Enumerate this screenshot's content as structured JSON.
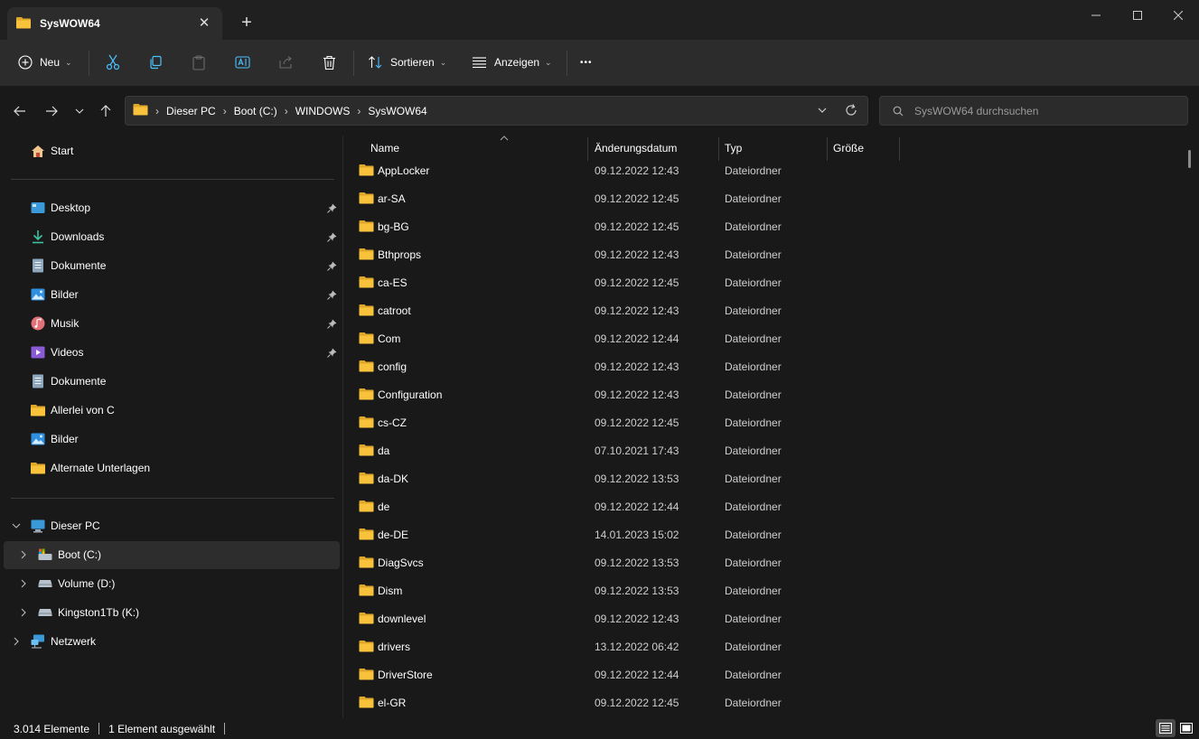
{
  "window": {
    "tab_title": "SysWOW64",
    "new_tab_glyph": "+",
    "close_glyph": "✕"
  },
  "toolbar": {
    "new_label": "Neu",
    "sort_label": "Sortieren",
    "view_label": "Anzeigen",
    "more_glyph": "•••"
  },
  "address": {
    "breadcrumbs": [
      "Dieser PC",
      "Boot (C:)",
      "WINDOWS",
      "SysWOW64"
    ],
    "search_placeholder": "SysWOW64 durchsuchen"
  },
  "sidebar": {
    "home": "Start",
    "quick_access": [
      {
        "label": "Desktop",
        "icon": "desktop-icon",
        "pinned": true
      },
      {
        "label": "Downloads",
        "icon": "download-icon",
        "pinned": true
      },
      {
        "label": "Dokumente",
        "icon": "document-icon",
        "pinned": true
      },
      {
        "label": "Bilder",
        "icon": "pictures-icon",
        "pinned": true
      },
      {
        "label": "Musik",
        "icon": "music-icon",
        "pinned": true
      },
      {
        "label": "Videos",
        "icon": "video-icon",
        "pinned": true
      },
      {
        "label": "Dokumente",
        "icon": "document-icon",
        "pinned": false
      },
      {
        "label": "Allerlei von C",
        "icon": "folder-icon",
        "pinned": false
      },
      {
        "label": "Bilder",
        "icon": "pictures-icon",
        "pinned": false
      },
      {
        "label": "Alternate Unterlagen",
        "icon": "folder-icon",
        "pinned": false
      }
    ],
    "this_pc": "Dieser PC",
    "drives": [
      {
        "label": "Boot (C:)",
        "selected": true
      },
      {
        "label": "Volume (D:)",
        "selected": false
      },
      {
        "label": "Kingston1Tb (K:)",
        "selected": false
      }
    ],
    "network": "Netzwerk"
  },
  "columns": {
    "name": "Name",
    "date": "Änderungsdatum",
    "type": "Typ",
    "size": "Größe"
  },
  "files": [
    {
      "name": "AppLocker",
      "date": "09.12.2022 12:43",
      "type": "Dateiordner"
    },
    {
      "name": "ar-SA",
      "date": "09.12.2022 12:45",
      "type": "Dateiordner"
    },
    {
      "name": "bg-BG",
      "date": "09.12.2022 12:45",
      "type": "Dateiordner"
    },
    {
      "name": "Bthprops",
      "date": "09.12.2022 12:43",
      "type": "Dateiordner"
    },
    {
      "name": "ca-ES",
      "date": "09.12.2022 12:45",
      "type": "Dateiordner"
    },
    {
      "name": "catroot",
      "date": "09.12.2022 12:43",
      "type": "Dateiordner"
    },
    {
      "name": "Com",
      "date": "09.12.2022 12:44",
      "type": "Dateiordner"
    },
    {
      "name": "config",
      "date": "09.12.2022 12:43",
      "type": "Dateiordner"
    },
    {
      "name": "Configuration",
      "date": "09.12.2022 12:43",
      "type": "Dateiordner"
    },
    {
      "name": "cs-CZ",
      "date": "09.12.2022 12:45",
      "type": "Dateiordner"
    },
    {
      "name": "da",
      "date": "07.10.2021 17:43",
      "type": "Dateiordner"
    },
    {
      "name": "da-DK",
      "date": "09.12.2022 13:53",
      "type": "Dateiordner"
    },
    {
      "name": "de",
      "date": "09.12.2022 12:44",
      "type": "Dateiordner"
    },
    {
      "name": "de-DE",
      "date": "14.01.2023 15:02",
      "type": "Dateiordner"
    },
    {
      "name": "DiagSvcs",
      "date": "09.12.2022 13:53",
      "type": "Dateiordner"
    },
    {
      "name": "Dism",
      "date": "09.12.2022 13:53",
      "type": "Dateiordner"
    },
    {
      "name": "downlevel",
      "date": "09.12.2022 12:43",
      "type": "Dateiordner"
    },
    {
      "name": "drivers",
      "date": "13.12.2022 06:42",
      "type": "Dateiordner"
    },
    {
      "name": "DriverStore",
      "date": "09.12.2022 12:44",
      "type": "Dateiordner"
    },
    {
      "name": "el-GR",
      "date": "09.12.2022 12:45",
      "type": "Dateiordner"
    }
  ],
  "status": {
    "item_count": "3.014 Elemente",
    "selection": "1 Element ausgewählt"
  },
  "colors": {
    "folder": "#f8c33b",
    "folder_dark": "#e0a82a",
    "accent": "#4cc2ff"
  }
}
